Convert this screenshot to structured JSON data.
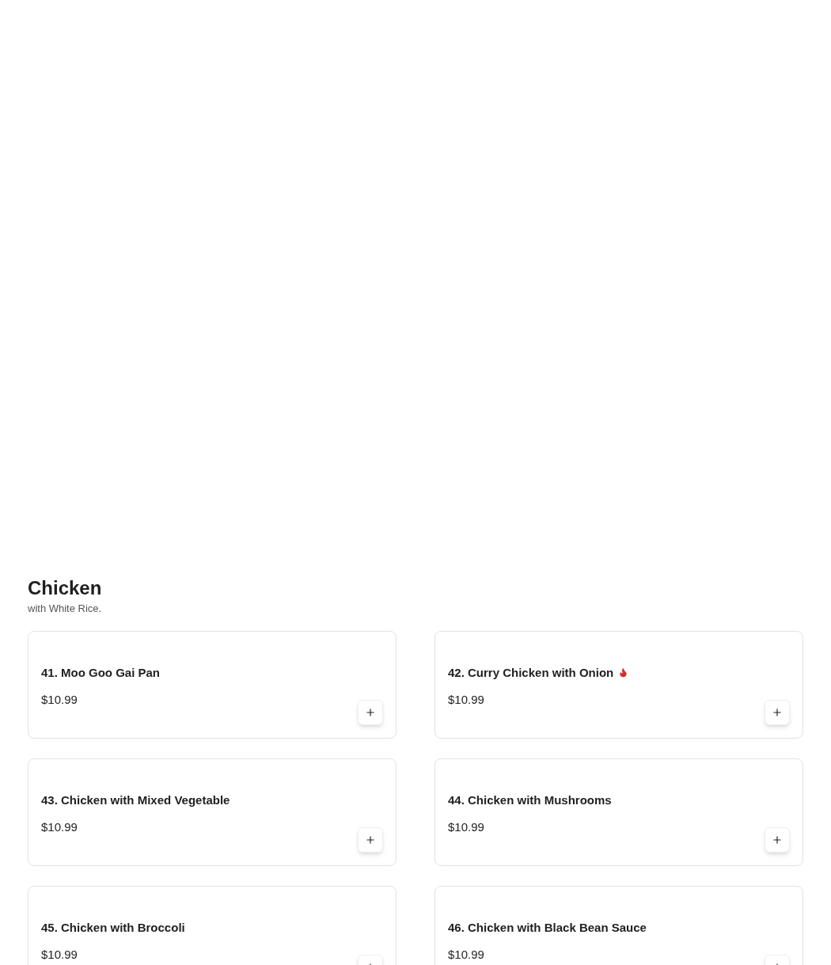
{
  "section": {
    "title": "Chicken",
    "subtitle": "with White Rice."
  },
  "items": [
    {
      "name": "41. Moo Goo Gai Pan",
      "price": "$10.99",
      "spicy": false
    },
    {
      "name": "42. Curry Chicken with Onion",
      "price": "$10.99",
      "spicy": true
    },
    {
      "name": "43. Chicken with Mixed Vegetable",
      "price": "$10.99",
      "spicy": false
    },
    {
      "name": "44. Chicken with Mushrooms",
      "price": "$10.99",
      "spicy": false
    },
    {
      "name": "45. Chicken with Broccoli",
      "price": "$10.99",
      "spicy": false
    },
    {
      "name": "46. Chicken with Black Bean Sauce",
      "price": "$10.99",
      "spicy": false
    }
  ]
}
